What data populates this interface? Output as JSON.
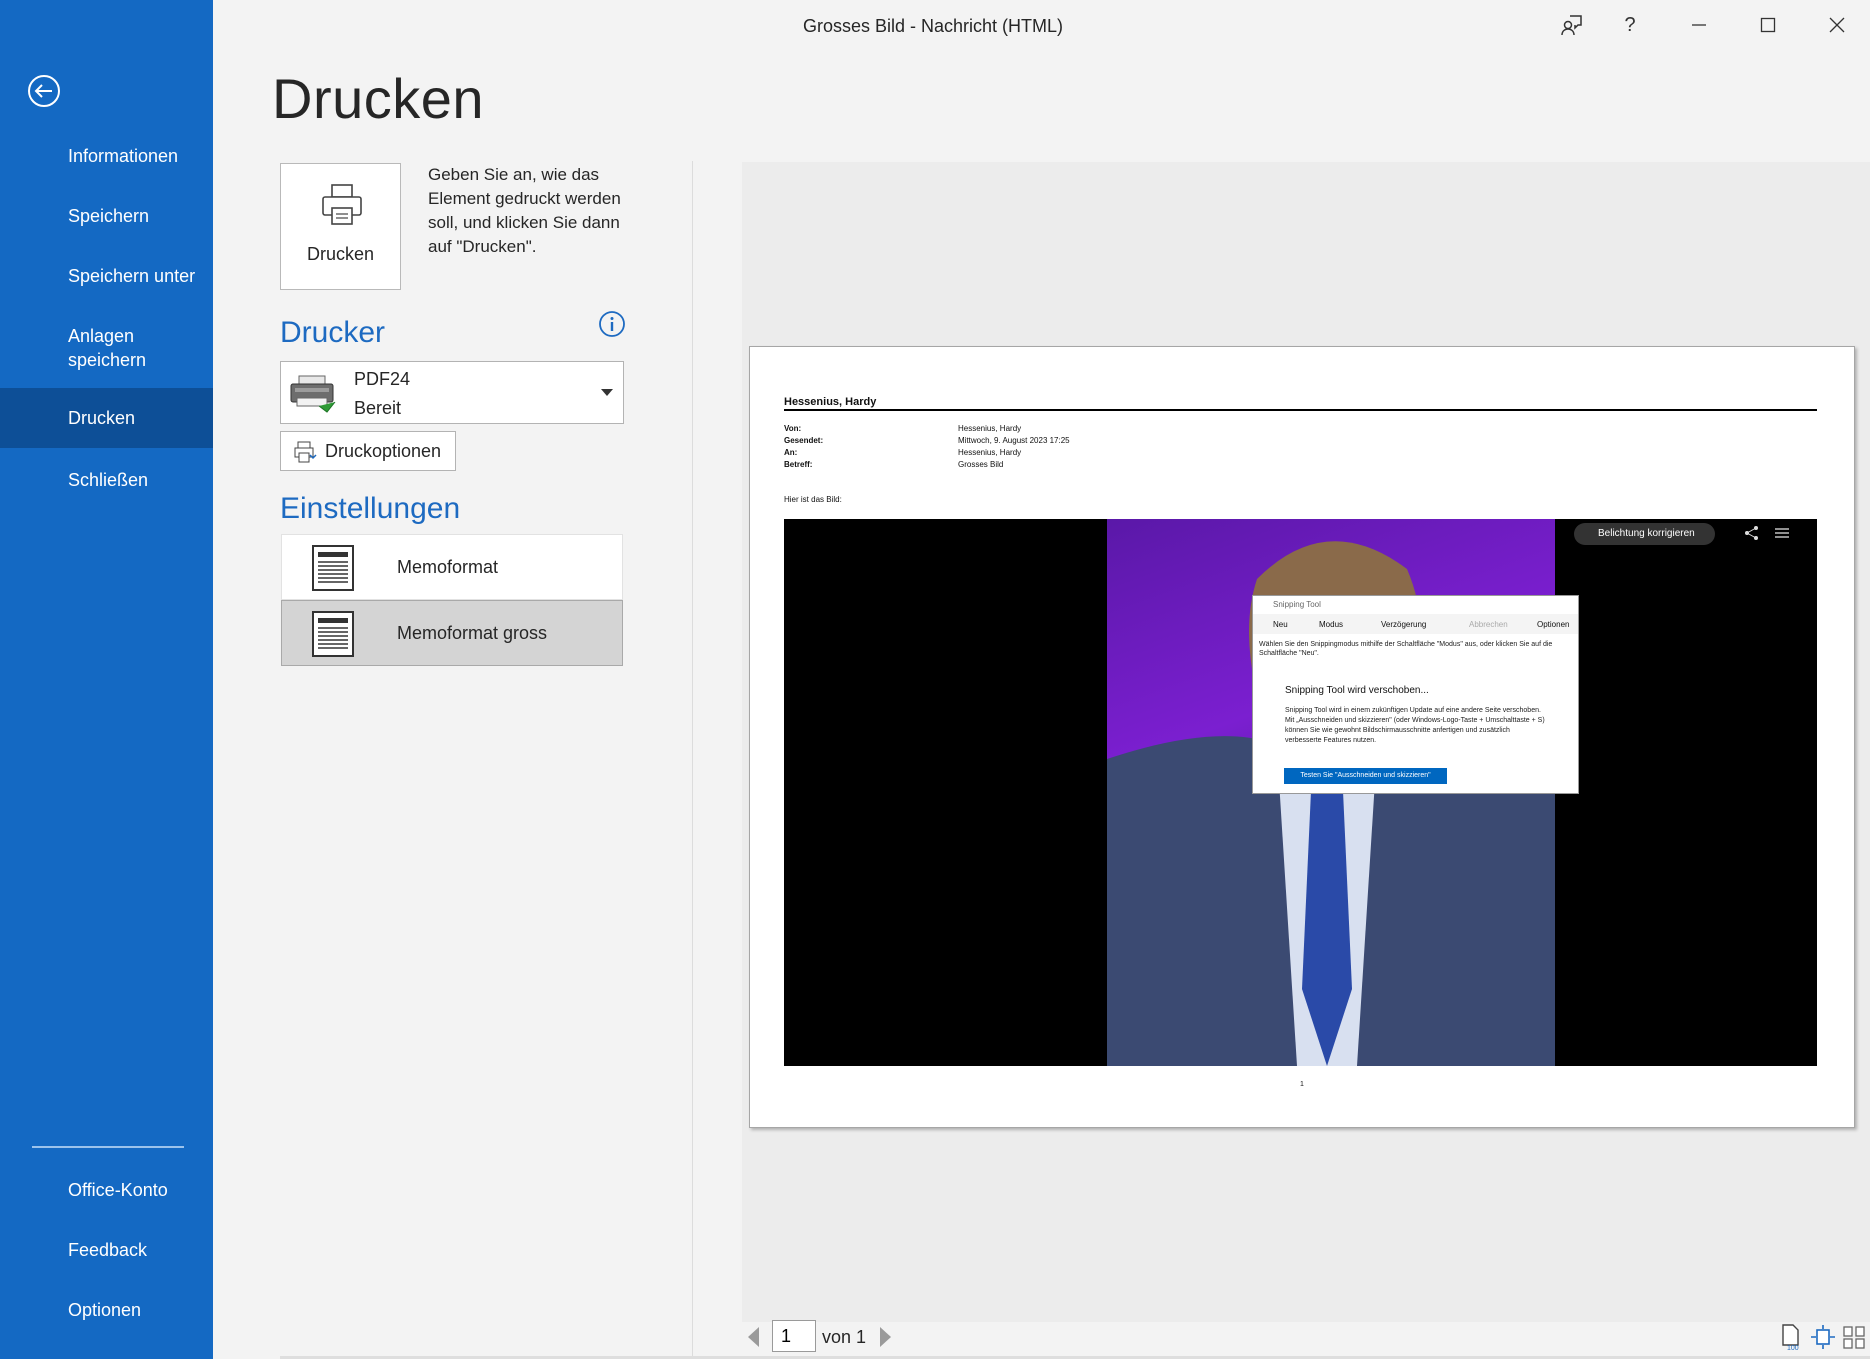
{
  "window": {
    "title": "Grosses Bild  -  Nachricht (HTML)",
    "controls": [
      "feedback-icon",
      "help-icon",
      "minimize-icon",
      "maximize-icon",
      "close-icon"
    ]
  },
  "sidebar": {
    "back_icon": "back-arrow-icon",
    "items": [
      {
        "label": "Informationen"
      },
      {
        "label": "Speichern"
      },
      {
        "label": "Speichern unter"
      },
      {
        "label": "Anlagen speichern"
      },
      {
        "label": "Drucken",
        "active": true
      },
      {
        "label": "Schließen"
      }
    ],
    "footer_items": [
      {
        "label": "Office-Konto"
      },
      {
        "label": "Feedback"
      },
      {
        "label": "Optionen"
      }
    ]
  },
  "main": {
    "heading": "Drucken",
    "print_button_label": "Drucken",
    "print_description": "Geben Sie an, wie das Element gedruckt werden soll, und klicken Sie dann auf \"Drucken\".",
    "printer_section_title": "Drucker",
    "printer": {
      "name": "PDF24",
      "status": "Bereit"
    },
    "print_options_label": "Druckoptionen",
    "settings_section_title": "Einstellungen",
    "styles": [
      {
        "label": "Memoformat",
        "selected": false
      },
      {
        "label": "Memoformat gross",
        "selected": true
      }
    ]
  },
  "preview": {
    "sender_name": "Hessenius, Hardy",
    "headers": [
      {
        "key": "Von:",
        "value": "Hessenius, Hardy"
      },
      {
        "key": "Gesendet:",
        "value": "Mittwoch, 9. August 2023 17:25"
      },
      {
        "key": "An:",
        "value": "Hessenius, Hardy"
      },
      {
        "key": "Betreff:",
        "value": "Grosses Bild"
      }
    ],
    "body_text": "Hier ist das Bild:",
    "photo_toolbar_chip": "Belichtung korrigieren",
    "snipping_tool": {
      "title": "Snipping Tool",
      "toolbar": [
        "Neu",
        "Modus",
        "Verzögerung",
        "Abbrechen",
        "Optionen"
      ],
      "hint": "Wählen Sie den Snippingmodus mithilfe der Schaltfläche \"Modus\" aus, oder klicken Sie auf die Schaltfläche \"Neu\".",
      "notice_title": "Snipping Tool wird verschoben...",
      "notice_text": "Snipping Tool wird in einem zukünftigen Update auf eine andere Seite verschoben. Mit „Ausschneiden und skizzieren\" (oder Windows-Logo-Taste + Umschalttaste + S) können Sie wie gewohnt Bildschirmausschnitte anfertigen und zusätzlich verbesserte Features nutzen.",
      "notice_button": "Testen Sie \"Ausschneiden und skizzieren\""
    },
    "page_number": "1"
  },
  "pager": {
    "current_page": "1",
    "of_label": "von 1",
    "zoom_badge": "100"
  },
  "colors": {
    "sidebar": "#1469c3",
    "sidebar_active": "#0d4f97",
    "accent": "#1d6ac1",
    "background": "#f3f3f3"
  }
}
